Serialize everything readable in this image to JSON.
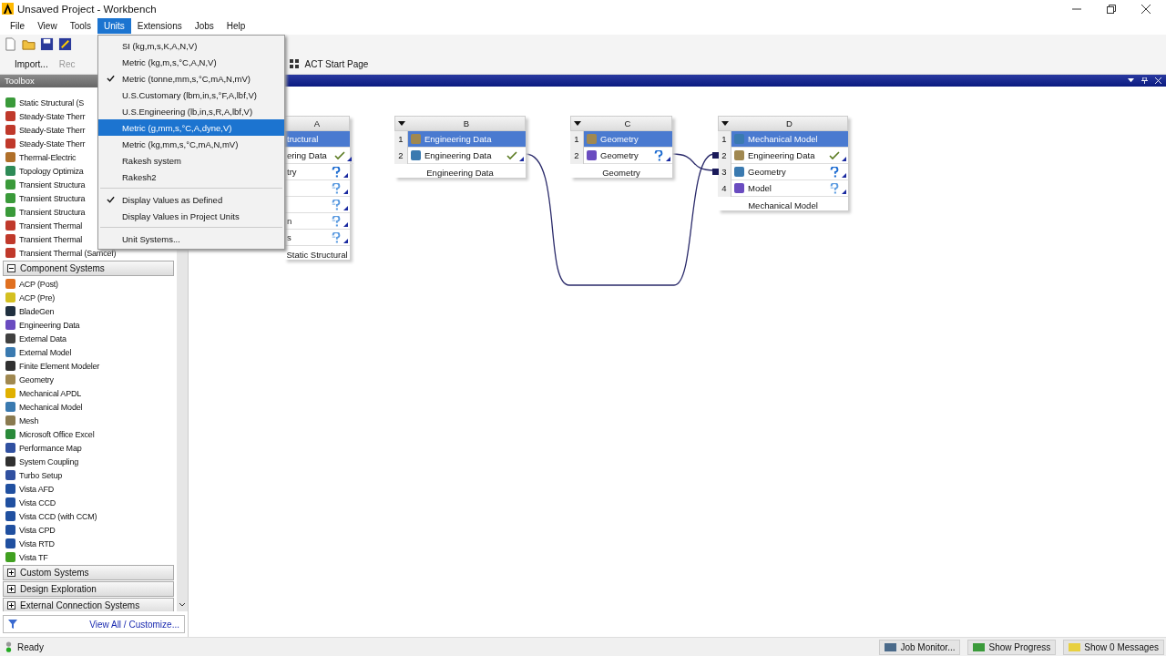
{
  "window": {
    "title": "Unsaved Project - Workbench"
  },
  "menu_bar": [
    {
      "label": "File",
      "selected": false
    },
    {
      "label": "View",
      "selected": false
    },
    {
      "label": "Tools",
      "selected": false
    },
    {
      "label": "Units",
      "selected": true
    },
    {
      "label": "Extensions",
      "selected": false
    },
    {
      "label": "Jobs",
      "selected": false
    },
    {
      "label": "Help",
      "selected": false
    }
  ],
  "toolbar": {
    "buttons": [
      {
        "label": "Import...",
        "disabled": false
      },
      {
        "label": "Rec",
        "disabled": true
      }
    ],
    "tab": "ACT Start Page"
  },
  "units_menu": [
    {
      "kind": "item",
      "label": "SI (kg,m,s,K,A,N,V)",
      "checked": false,
      "selected": false
    },
    {
      "kind": "item",
      "label": "Metric (kg,m,s,°C,A,N,V)",
      "checked": false,
      "selected": false
    },
    {
      "kind": "item",
      "label": "Metric (tonne,mm,s,°C,mA,N,mV)",
      "checked": true,
      "selected": false
    },
    {
      "kind": "item",
      "label": "U.S.Customary (lbm,in,s,°F,A,lbf,V)",
      "checked": false,
      "selected": false
    },
    {
      "kind": "item",
      "label": "U.S.Engineering (lb,in,s,R,A,lbf,V)",
      "checked": false,
      "selected": false
    },
    {
      "kind": "item",
      "label": "Metric (g,mm,s,°C,A,dyne,V)",
      "checked": false,
      "selected": true
    },
    {
      "kind": "item",
      "label": "Metric (kg,mm,s,°C,mA,N,mV)",
      "checked": false,
      "selected": false
    },
    {
      "kind": "item",
      "label": "Rakesh system",
      "checked": false,
      "selected": false
    },
    {
      "kind": "item",
      "label": "Rakesh2",
      "checked": false,
      "selected": false
    },
    {
      "kind": "separator"
    },
    {
      "kind": "item",
      "label": "Display Values as Defined",
      "checked": true,
      "selected": false
    },
    {
      "kind": "item",
      "label": "Display Values in Project Units",
      "checked": false,
      "selected": false
    },
    {
      "kind": "separator"
    },
    {
      "kind": "item",
      "label": "Unit Systems...",
      "checked": false,
      "selected": false
    }
  ],
  "toolbox": {
    "title": "Toolbox",
    "analysis_items": [
      "Static Structural (S",
      "Steady-State Therr",
      "Steady-State Therr",
      "Steady-State Therr",
      "Thermal-Electric",
      "Topology Optimiza",
      "Transient Structura",
      "Transient Structura",
      "Transient Structura",
      "Transient Thermal",
      "Transient Thermal",
      "Transient Thermal (Samcef)"
    ],
    "groups": [
      {
        "label": "Component Systems",
        "expanded": true,
        "items": [
          "ACP (Post)",
          "ACP (Pre)",
          "BladeGen",
          "Engineering Data",
          "External Data",
          "External Model",
          "Finite Element Modeler",
          "Geometry",
          "Mechanical APDL",
          "Mechanical Model",
          "Mesh",
          "Microsoft Office Excel",
          "Performance Map",
          "System Coupling",
          "Turbo Setup",
          "Vista AFD",
          "Vista CCD",
          "Vista CCD (with CCM)",
          "Vista CPD",
          "Vista RTD",
          "Vista TF"
        ]
      },
      {
        "label": "Custom Systems",
        "expanded": false
      },
      {
        "label": "Design Exploration",
        "expanded": false
      },
      {
        "label": "External Connection Systems",
        "expanded": false
      }
    ],
    "footer_link": "View All / Customize..."
  },
  "schematic": {
    "systems": [
      {
        "letter": "A",
        "caption": "Static Structural",
        "rows": [
          {
            "label": "tructural",
            "kind": "title"
          },
          {
            "label": "ering Data",
            "kind": "check"
          },
          {
            "label": "try",
            "kind": "question"
          },
          {
            "kind": "refresh"
          },
          {
            "kind": "refresh"
          },
          {
            "label": "n",
            "kind": "refresh"
          },
          {
            "label": "s",
            "kind": "refresh"
          }
        ]
      },
      {
        "letter": "B",
        "caption": "Engineering Data",
        "rows": [
          {
            "num": "1",
            "label": "Engineering Data",
            "kind": "title"
          },
          {
            "num": "2",
            "label": "Engineering Data",
            "kind": "check"
          }
        ]
      },
      {
        "letter": "C",
        "caption": "Geometry",
        "rows": [
          {
            "num": "1",
            "label": "Geometry",
            "kind": "title"
          },
          {
            "num": "2",
            "label": "Geometry",
            "kind": "question"
          }
        ]
      },
      {
        "letter": "D",
        "caption": "Mechanical Model",
        "rows": [
          {
            "num": "1",
            "label": "Mechanical Model",
            "kind": "title"
          },
          {
            "num": "2",
            "label": "Engineering Data",
            "kind": "check"
          },
          {
            "num": "3",
            "label": "Geometry",
            "kind": "question"
          },
          {
            "num": "4",
            "label": "Model",
            "kind": "refresh"
          }
        ]
      }
    ]
  },
  "status_bar": {
    "text": "Ready",
    "buttons": [
      "Job Monitor...",
      "Show Progress",
      "Show 0 Messages"
    ]
  }
}
